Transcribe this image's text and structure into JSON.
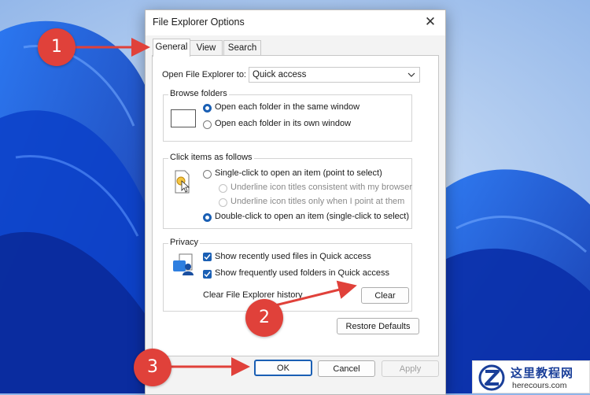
{
  "window": {
    "title": "File Explorer Options",
    "close_glyph": "✕"
  },
  "tabs": [
    {
      "label": "General",
      "active": true
    },
    {
      "label": "View",
      "active": false
    },
    {
      "label": "Search",
      "active": false
    }
  ],
  "general": {
    "open_to_label": "Open File Explorer to:",
    "open_to_value": "Quick access",
    "browse_folders": {
      "title": "Browse folders",
      "options": [
        {
          "label": "Open each folder in the same window",
          "selected": true
        },
        {
          "label": "Open each folder in its own window",
          "selected": false
        }
      ]
    },
    "click_items": {
      "title": "Click items as follows",
      "single_click": "Single-click to open an item (point to select)",
      "underline_consistent": "Underline icon titles consistent with my browser",
      "underline_point": "Underline icon titles only when I point at them",
      "double_click": "Double-click to open an item (single-click to select)"
    },
    "privacy": {
      "title": "Privacy",
      "recent_files": "Show recently used files in Quick access",
      "frequent_folders": "Show frequently used folders in Quick access",
      "clear_history_label": "Clear File Explorer history",
      "clear_button": "Clear"
    },
    "restore_defaults": "Restore Defaults"
  },
  "buttons": {
    "ok": "OK",
    "cancel": "Cancel",
    "apply": "Apply"
  },
  "annotations": {
    "step1": "1",
    "step2": "2",
    "step3": "3"
  },
  "watermark": {
    "cn": "这里教程网",
    "en": "herecours.com"
  },
  "colors": {
    "accent": "#1a5fb4",
    "annotation": "#e0413a",
    "wallpaper": "#1c56d6"
  }
}
